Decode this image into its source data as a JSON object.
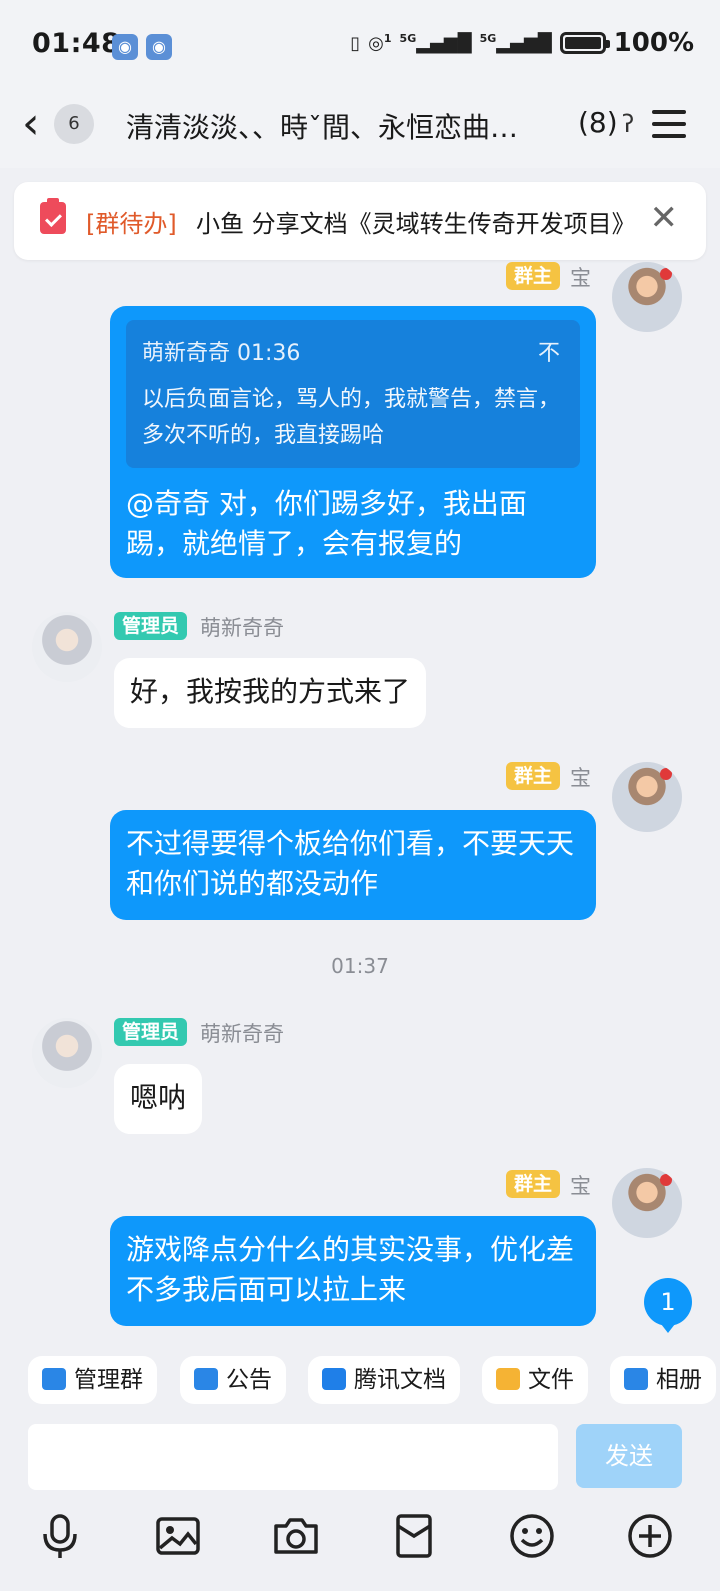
{
  "status": {
    "time": "01:48",
    "battery": "100%",
    "network": "5G",
    "network2": "5G",
    "sim_index": "1",
    "app_icons": [
      "notification-app-icon",
      "notification-app-icon"
    ]
  },
  "header": {
    "back_count": "6",
    "title": "清清淡淡、、時ˇ間、永恒恋曲…",
    "member_count": "(8)"
  },
  "todo": {
    "tag": "[群待办]",
    "text": "小鱼 分享文档《灵域转生传奇开发项目》"
  },
  "messages": [
    {
      "badge": "群主",
      "nick": "宝",
      "quote_head": "萌新奇奇 01:36",
      "quote_body": "以后负面言论，骂人的，我就警告，禁言，多次不听的，我直接踢哈",
      "text": "@奇奇 对，你们踢多好，我出面踢，就绝情了，会有报复的"
    },
    {
      "badge": "管理员",
      "nick": "萌新奇奇",
      "text": "好，我按我的方式来了"
    },
    {
      "badge": "群主",
      "nick": "宝",
      "text": "不过得要得个板给你们看，不要天天和你们说的都没动作"
    },
    {
      "divider": "01:37"
    },
    {
      "badge": "管理员",
      "nick": "萌新奇奇",
      "text": "嗯呐"
    },
    {
      "badge": "群主",
      "nick": "宝",
      "text": "游戏降点分什么的其实没事，优化差不多我后面可以拉上来"
    }
  ],
  "unread_count": "1",
  "shortcuts": [
    "管理群",
    "公告",
    "腾讯文档",
    "文件",
    "相册"
  ],
  "input": {
    "placeholder": "",
    "send_label": "发送"
  },
  "toolbar": [
    "microphone-icon",
    "image-icon",
    "camera-icon",
    "red-packet-icon",
    "emoji-icon",
    "plus-icon"
  ],
  "colors": {
    "accent": "#0e98fb",
    "owner_badge": "#f5c342",
    "admin_badge": "#33c9b0",
    "todo_tag": "#e05a2a"
  }
}
